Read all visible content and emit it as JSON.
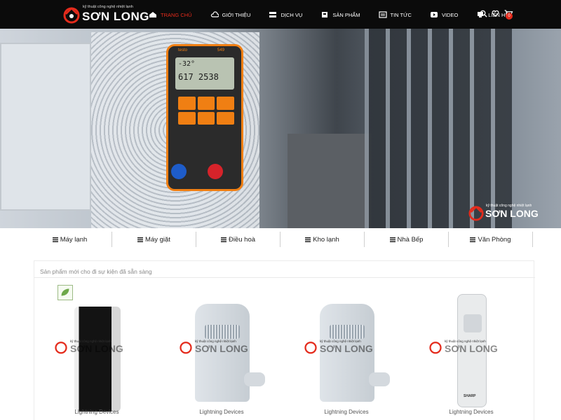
{
  "brand": {
    "tagline": "kỹ thuật công nghệ nhiệt lạnh",
    "name": "SƠN LONG",
    "accent_color": "#e42b1c"
  },
  "nav": [
    {
      "label": "Trang chủ",
      "icon": "home-icon",
      "active": true
    },
    {
      "label": "Giới thiệu",
      "icon": "cloud-icon",
      "active": false
    },
    {
      "label": "Dịch vụ",
      "icon": "server-icon",
      "active": false
    },
    {
      "label": "Sản phẩm",
      "icon": "product-icon",
      "active": false
    },
    {
      "label": "Tin tức",
      "icon": "news-icon",
      "active": false
    },
    {
      "label": "Video",
      "icon": "video-icon",
      "active": false
    },
    {
      "label": "Liên hệ",
      "icon": "contact-icon",
      "active": false
    }
  ],
  "tools": {
    "search_icon": "search-icon",
    "wishlist_icon": "heart-icon",
    "cart_icon": "cart-icon",
    "cart_count": "0"
  },
  "banner": {
    "gauge_brand": "testo",
    "gauge_model": "549",
    "reading_top": "-32°",
    "reading_bottom": "617 2538"
  },
  "categories": [
    "Máy lạnh",
    "Máy giặt",
    "Điều hoà",
    "Kho lạnh",
    "Nhà Bếp",
    "Văn Phòng"
  ],
  "section": {
    "title": "Sản phẩm mới cho đi sự kiện đã sẵn sàng"
  },
  "products": [
    {
      "label": "Lightning Devices",
      "type": "portable-ac-black"
    },
    {
      "label": "Lightning Devices",
      "type": "portable-ac-white"
    },
    {
      "label": "Lightning Devices",
      "type": "portable-ac-white"
    },
    {
      "label": "Lightning Devices",
      "type": "remote-control",
      "brand": "SHARP"
    }
  ]
}
